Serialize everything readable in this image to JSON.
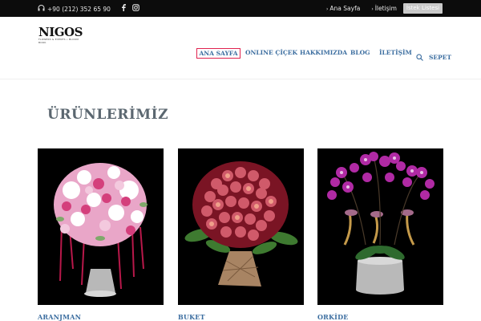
{
  "topbar": {
    "phone": "+90 (212) 352 65 90",
    "links": [
      "Ana Sayfa",
      "İletişim"
    ],
    "wishlist_button": "İstek Listesi"
  },
  "brand": {
    "logo_text": "NIGOS",
    "logo_sub": "FLOWERS & EVENTS • BLOOM BOOK"
  },
  "nav": {
    "items": [
      "ANA SAYFA",
      "ONLINE ÇİÇEK",
      "HAKKIMIZDA",
      "BLOG",
      "İLETİŞİM"
    ],
    "cart": "SEPET"
  },
  "main": {
    "title": "ÜRÜNLERİMİZ",
    "products": [
      {
        "label": "ARANJMAN"
      },
      {
        "label": "BUKET"
      },
      {
        "label": "ORKİDE"
      }
    ]
  }
}
